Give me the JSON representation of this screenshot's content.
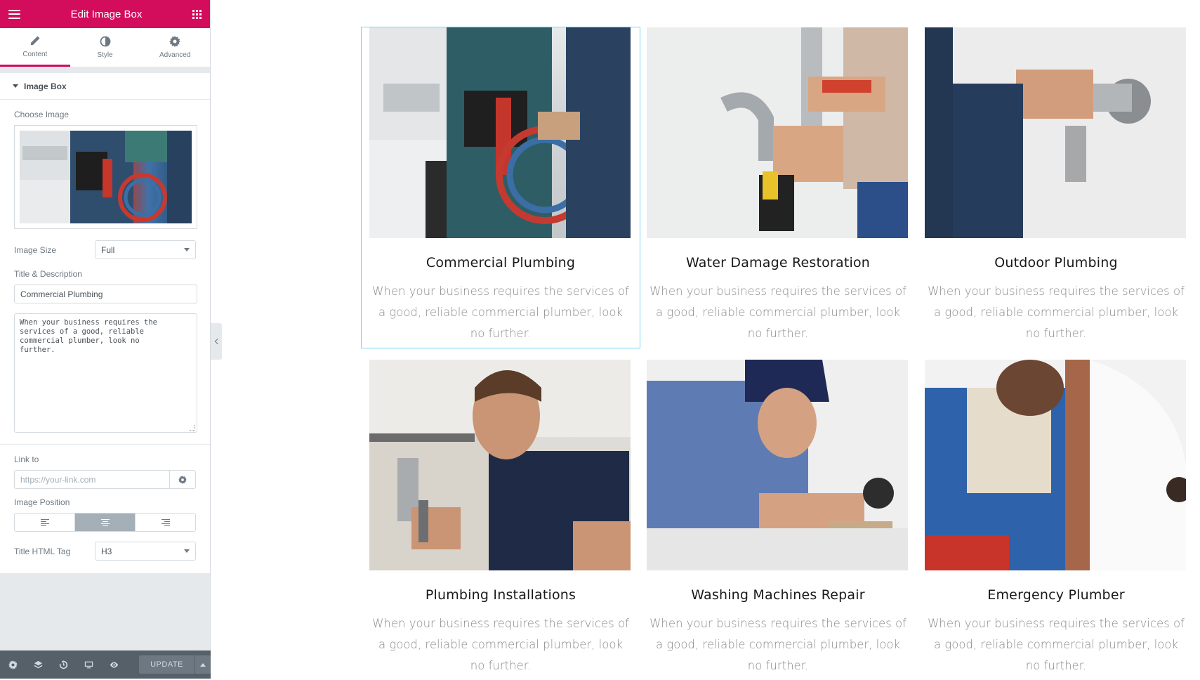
{
  "panel": {
    "header_title": "Edit Image Box",
    "tabs": [
      {
        "label": "Content",
        "icon": "pencil-icon"
      },
      {
        "label": "Style",
        "icon": "contrast-icon"
      },
      {
        "label": "Advanced",
        "icon": "gear-icon"
      }
    ],
    "active_tab": "Content",
    "section_title": "Image Box",
    "choose_image_label": "Choose Image",
    "image_size_label": "Image Size",
    "image_size_value": "Full",
    "title_desc_label": "Title & Description",
    "title_value": "Commercial Plumbing",
    "description_value": "When your business requires the\nservices of a good, reliable\ncommercial plumber, look no\nfurther.",
    "link_label": "Link to",
    "link_placeholder": "https://your-link.com",
    "image_position_label": "Image Position",
    "image_position_selected": "top",
    "title_tag_label": "Title HTML Tag",
    "title_tag_value": "H3",
    "footer": {
      "update_label": "UPDATE"
    }
  },
  "cards": [
    {
      "title": "Commercial Plumbing",
      "description": "When your business requires the services of a good, reliable commercial plumber, look no further."
    },
    {
      "title": "Water Damage Restoration",
      "description": "When your business requires the services of a good, reliable commercial plumber, look no further."
    },
    {
      "title": "Outdoor Plumbing",
      "description": "When your business requires the services of a good, reliable commercial plumber, look no further."
    },
    {
      "title": "Plumbing Installations",
      "description": "When your business requires the services of a good, reliable commercial plumber, look no further."
    },
    {
      "title": "Washing Machines Repair",
      "description": "When your business requires the services of a good, reliable commercial plumber, look no further."
    },
    {
      "title": "Emergency Plumber",
      "description": "When your business requires the services of a good, reliable commercial plumber, look no further."
    }
  ],
  "colors": {
    "brand": "#d30c5c",
    "selection_outline": "#71d7f7",
    "panel_bg": "#e6e9ec",
    "footer_bg": "#556068"
  }
}
